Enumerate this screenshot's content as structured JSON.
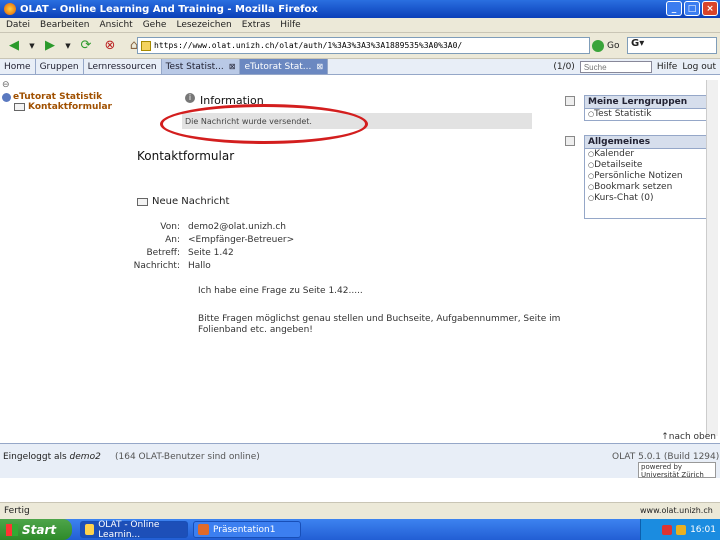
{
  "window": {
    "title": "OLAT - Online Learning And Training - Mozilla Firefox"
  },
  "menu": [
    "Datei",
    "Bearbeiten",
    "Ansicht",
    "Gehe",
    "Lesezeichen",
    "Extras",
    "Hilfe"
  ],
  "nav": {
    "url": "https://www.olat.unizh.ch/olat/auth/1%3A3%3A3%3A1889535%3A0%3A0/",
    "go_label": "Go"
  },
  "tabs": [
    {
      "label": "Home"
    },
    {
      "label": "Gruppen"
    },
    {
      "label": "Lernressourcen"
    },
    {
      "label": "Test Statist..."
    },
    {
      "label": "eTutorat Stat..."
    }
  ],
  "tabs_right": {
    "counter": "(1/0)",
    "search_placeholder": "Suche",
    "help": "Hilfe",
    "logout": "Log out"
  },
  "tree": {
    "root": "eTutorat Statistik",
    "child": "Kontaktformular"
  },
  "info": {
    "title": "Information",
    "message": "Die Nachricht wurde versendet."
  },
  "form": {
    "title": "Kontaktformular",
    "section": "Neue Nachricht",
    "fields": [
      {
        "label": "Von:",
        "value": "demo2@olat.unizh.ch"
      },
      {
        "label": "An:",
        "value": "<Empfänger-Betreuer>"
      },
      {
        "label": "Betreff:",
        "value": "Seite 1.42"
      },
      {
        "label": "Nachricht:",
        "value": "Hallo"
      }
    ],
    "body": [
      "Ich habe eine Frage zu Seite 1.42.....",
      "Bitte Fragen möglichst genau stellen und Buchseite, Aufgabennummer, Seite im Folienband etc. angeben!"
    ]
  },
  "sidebar": {
    "groups_title": "Meine Lerngruppen",
    "groups": [
      "Test Statistik"
    ],
    "general_title": "Allgemeines",
    "general": [
      "Kalender",
      "Detailseite",
      "Persönliche Notizen",
      "Bookmark setzen",
      "Kurs-Chat (0)"
    ]
  },
  "footer": {
    "toplink": "nach oben",
    "login_prefix": "Eingeloggt als",
    "login_user": "demo2",
    "users_online": "(164 OLAT-Benutzer sind online)",
    "version": "OLAT 5.0.1 (Build 1294)",
    "uzh_logo": "powered by Universität Zürich"
  },
  "status": {
    "text": "Fertig",
    "domain": "www.olat.unizh.ch"
  },
  "taskbar": {
    "start": "Start",
    "tasks": [
      "OLAT - Online Learnin...",
      "Präsentation1"
    ],
    "clock": "16:01"
  }
}
